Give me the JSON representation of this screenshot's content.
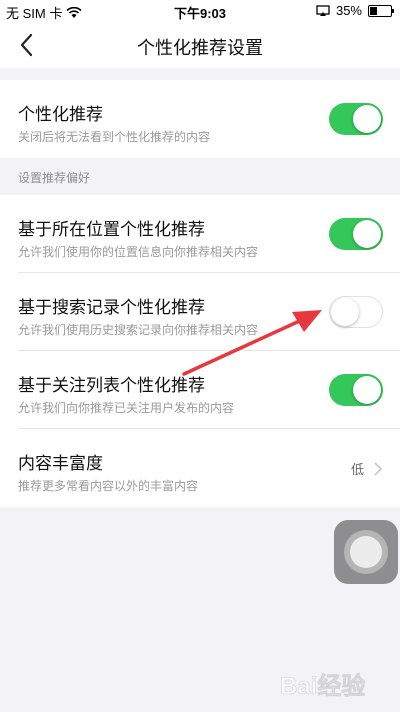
{
  "status_bar": {
    "carrier": "无 SIM 卡",
    "time": "下午9:03",
    "battery": "35%",
    "battery_level": 0.35
  },
  "nav": {
    "title": "个性化推荐设置",
    "back_icon": "chevron-left-icon"
  },
  "top_setting": {
    "title": "个性化推荐",
    "subtitle": "关闭后将无法看到个性化推荐的内容",
    "enabled": true
  },
  "preferences_header": "设置推荐偏好",
  "preferences": [
    {
      "title": "基于所在位置个性化推荐",
      "subtitle": "允许我们使用你的位置信息向你推荐相关内容",
      "enabled": true
    },
    {
      "title": "基于搜索记录个性化推荐",
      "subtitle": "允许我们使用历史搜索记录向你推荐相关内容",
      "enabled": false
    },
    {
      "title": "基于关注列表个性化推荐",
      "subtitle": "允许我们向你推荐已关注用户发布的内容",
      "enabled": true
    }
  ],
  "richness": {
    "title": "内容丰富度",
    "subtitle": "推荐更多常看内容以外的丰富内容",
    "value": "低"
  },
  "colors": {
    "toggle_on": "#34c759",
    "annotation_arrow": "#e8383d"
  },
  "watermark": {
    "text": "Bai经验"
  }
}
